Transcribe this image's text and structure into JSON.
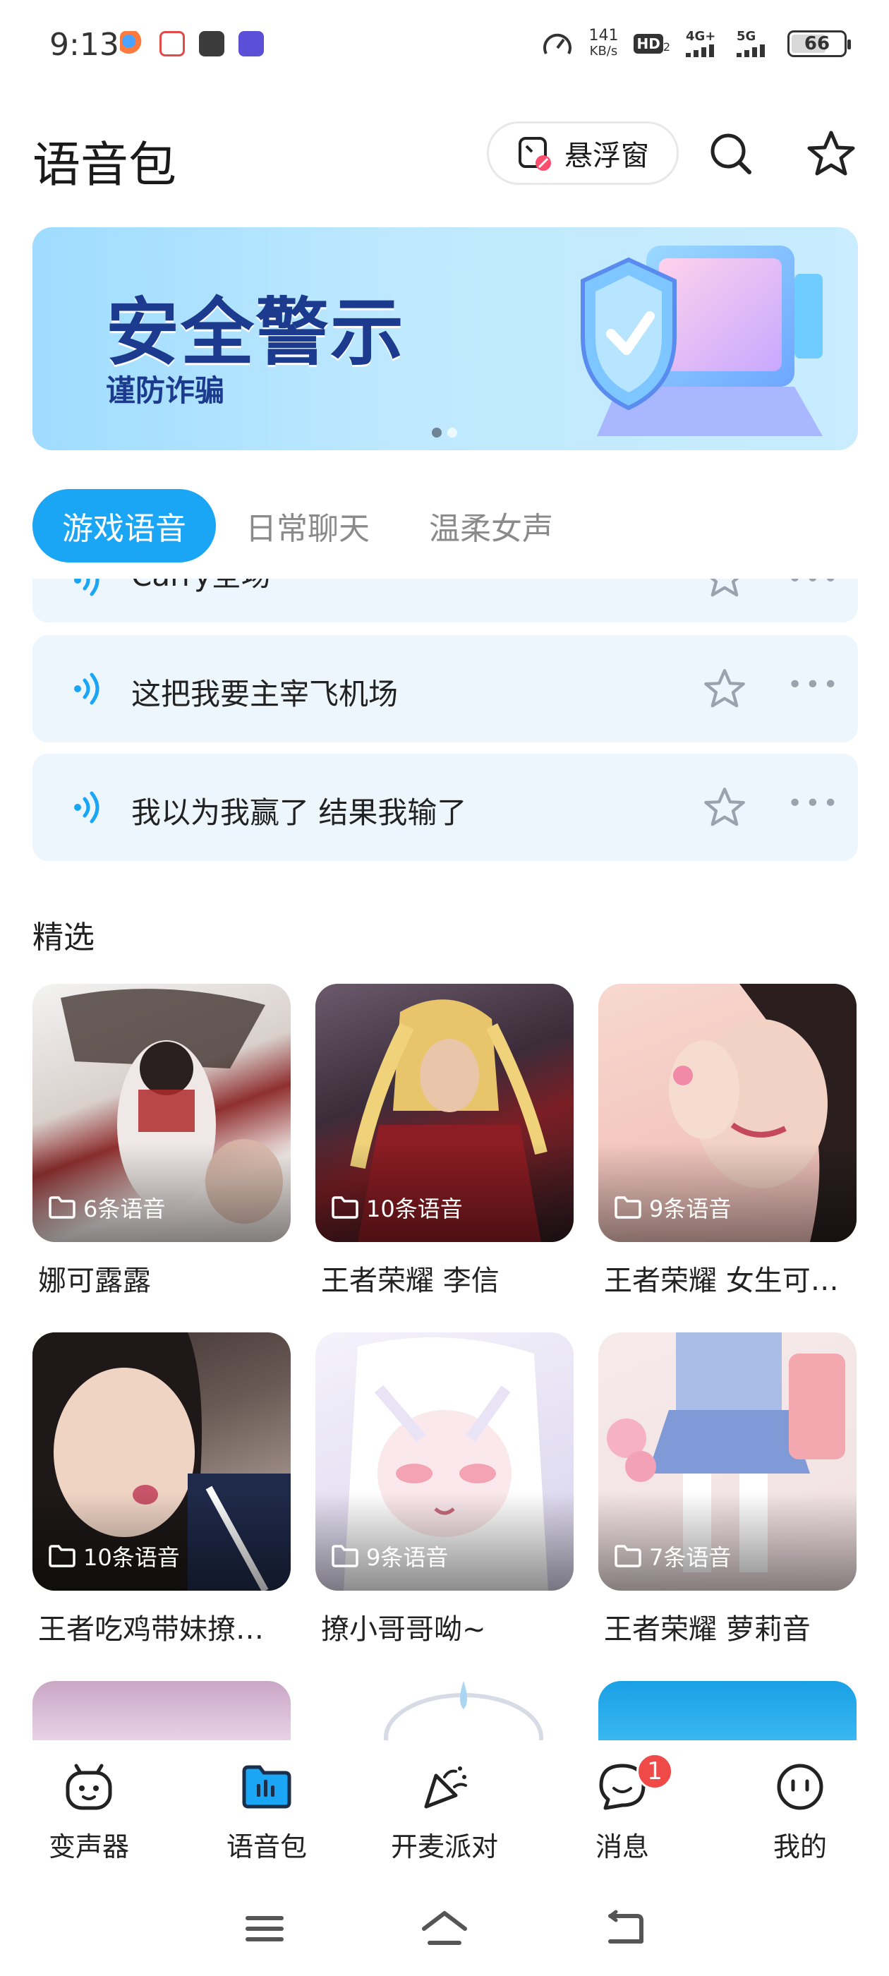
{
  "status_bar": {
    "time": "9:13",
    "net_speed_value": "141",
    "net_speed_unit": "KB/s",
    "hd_label": "HD",
    "hd_sub": "2",
    "sig1_label": "4G+",
    "sig2_label": "5G",
    "battery": "66",
    "battery_level_percent": 66
  },
  "header": {
    "title": "语音包",
    "float_window_label": "悬浮窗"
  },
  "banner": {
    "title": "安全警示",
    "subtitle": "谨防诈骗",
    "page_count": 2,
    "active_page": 1
  },
  "tabs": [
    {
      "label": "游戏语音",
      "active": true
    },
    {
      "label": "日常聊天",
      "active": false
    },
    {
      "label": "温柔女声",
      "active": false
    }
  ],
  "voice_list": [
    {
      "text": "Carry全场"
    },
    {
      "text": "这把我要主宰飞机场"
    },
    {
      "text": "我以为我赢了 结果我输了"
    }
  ],
  "featured": {
    "title": "精选",
    "cards": [
      {
        "count": "6条语音",
        "title": "娜可露露"
      },
      {
        "count": "10条语音",
        "title": "王者荣耀 李信"
      },
      {
        "count": "9条语音",
        "title": "王者荣耀 女生可…"
      },
      {
        "count": "10条语音",
        "title": "王者吃鸡带妹撩…"
      },
      {
        "count": "9条语音",
        "title": "撩小哥哥呦~"
      },
      {
        "count": "7条语音",
        "title": "王者荣耀 萝莉音"
      }
    ]
  },
  "bottom_nav": [
    {
      "label": "变声器",
      "icon": "robot-face-icon"
    },
    {
      "label": "语音包",
      "icon": "voice-folder-icon",
      "active": true
    },
    {
      "label": "开麦派对",
      "icon": "party-popper-icon"
    },
    {
      "label": "消息",
      "icon": "chat-bubble-icon",
      "badge": "1"
    },
    {
      "label": "我的",
      "icon": "smile-face-icon"
    }
  ],
  "colors": {
    "accent": "#1aa6f5",
    "list_bg": "#eef6fd",
    "badge": "#f04a48",
    "banner_text": "#1c3b8f"
  }
}
